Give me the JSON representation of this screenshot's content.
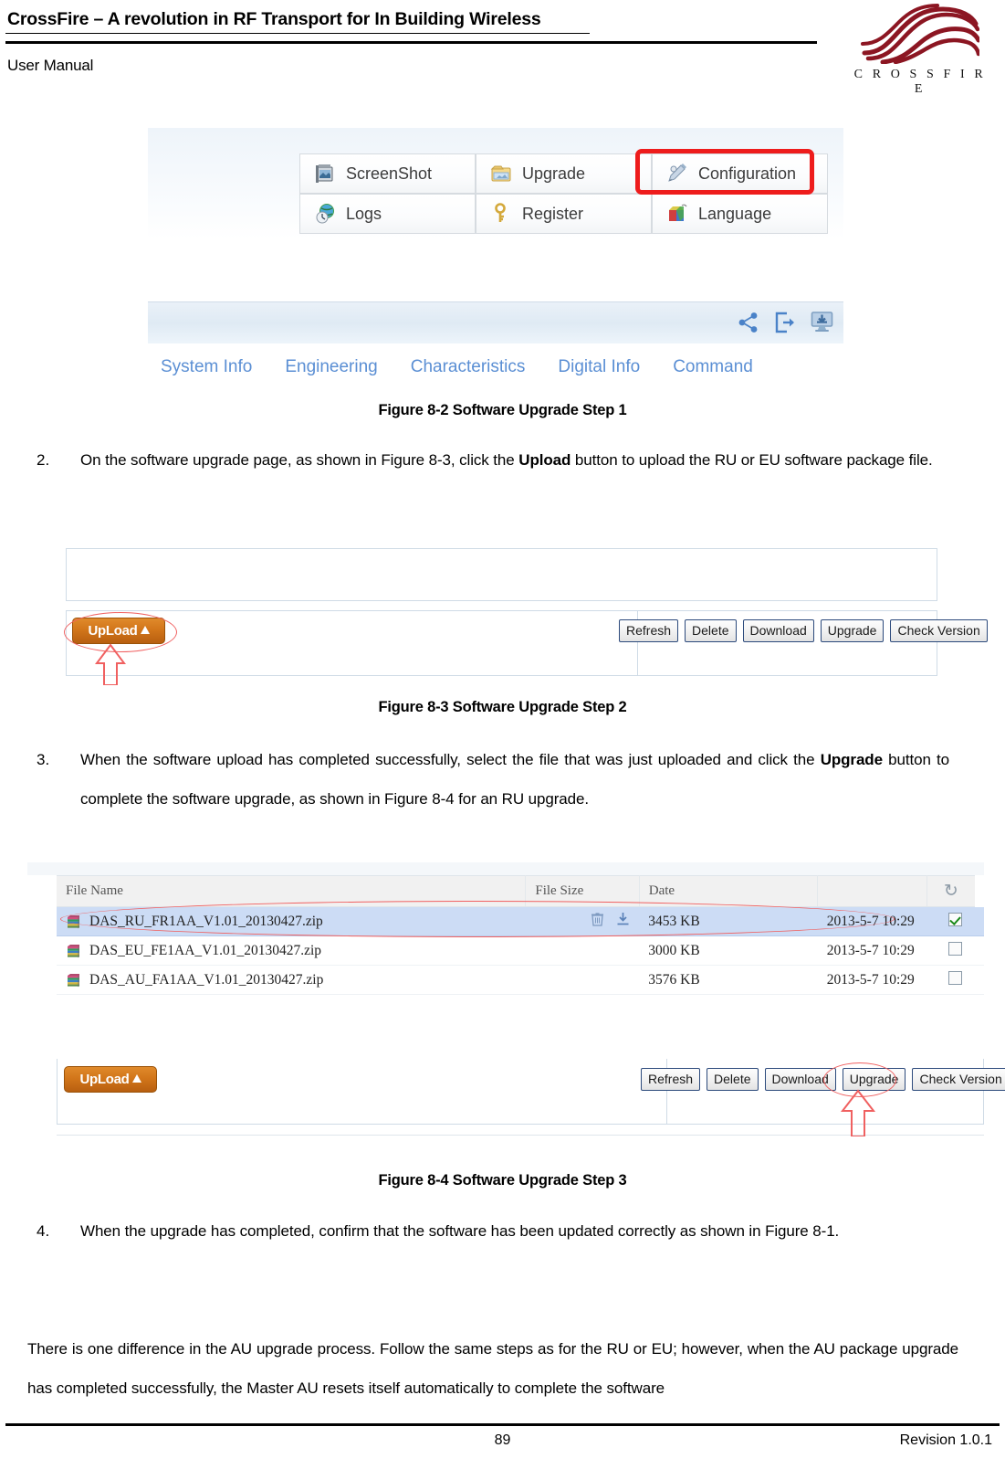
{
  "header": {
    "title": "CrossFire – A revolution in RF Transport for In Building Wireless",
    "subtitle": "User Manual",
    "logo_text": "C R O S S F I R E",
    "logo_icon": "crossfire-wave-logo"
  },
  "figure_8_2": {
    "menu_buttons": [
      {
        "label": "ScreenShot",
        "icon": "screenshot-icon",
        "highlighted": false
      },
      {
        "label": "Upgrade",
        "icon": "upgrade-folder-icon",
        "highlighted": true
      },
      {
        "label": "Configuration",
        "icon": "configuration-pencil-icon",
        "highlighted": false
      },
      {
        "label": "Logs",
        "icon": "logs-globe-icon",
        "highlighted": false
      },
      {
        "label": "Register",
        "icon": "register-key-icon",
        "highlighted": false
      },
      {
        "label": "Language",
        "icon": "language-cube-icon",
        "highlighted": false
      }
    ],
    "toolbar_icons": [
      "share-icon",
      "export-icon",
      "download-to-computer-icon"
    ],
    "tabs": [
      "System Info",
      "Engineering",
      "Characteristics",
      "Digital Info",
      "Command"
    ],
    "caption": "Figure 8-2 Software Upgrade Step 1"
  },
  "step_2": {
    "number": "2.",
    "text_before_bold": "On the software upgrade page, as shown in Figure 8-3, click the ",
    "bold_word": "Upload",
    "text_after_bold": " button to upload the RU or EU software package file."
  },
  "figure_8_3": {
    "upload_label": "UpLoad",
    "upload_icon": "upload-arrow-icon",
    "buttons": [
      "Refresh",
      "Delete",
      "Download",
      "Upgrade",
      "Check Version"
    ],
    "highlight_target": "UpLoad",
    "caption": "Figure 8-3 Software Upgrade Step 2"
  },
  "step_3": {
    "number": "3.",
    "text_before_bold": "When the software upload has completed successfully, select the file that was just uploaded and click the ",
    "bold_word": "Upgrade",
    "text_after_bold": " button to complete the software upgrade, as shown in Figure 8-4 for an RU upgrade."
  },
  "figure_8_4": {
    "table": {
      "columns": [
        "File Name",
        "File Size",
        "Date",
        "",
        ""
      ],
      "refresh_icon": "refresh-icon",
      "rows": [
        {
          "icon": "zip-archive-icon",
          "file_name": "DAS_RU_FR1AA_V1.01_20130427.zip",
          "file_size": "3453 KB",
          "date": "2013-5-7 10:29",
          "checked": true,
          "selected": true,
          "actions": [
            "delete-icon",
            "download-icon"
          ]
        },
        {
          "icon": "zip-archive-icon",
          "file_name": "DAS_EU_FE1AA_V1.01_20130427.zip",
          "file_size": "3000 KB",
          "date": "2013-5-7 10:29",
          "checked": false,
          "selected": false,
          "actions": []
        },
        {
          "icon": "zip-archive-icon",
          "file_name": "DAS_AU_FA1AA_V1.01_20130427.zip",
          "file_size": "3576 KB",
          "date": "2013-5-7 10:29",
          "checked": false,
          "selected": false,
          "actions": []
        }
      ]
    },
    "upload_label": "UpLoad",
    "buttons": [
      "Refresh",
      "Delete",
      "Download",
      "Upgrade",
      "Check Version"
    ],
    "highlight_target": "Upgrade",
    "caption": "Figure 8-4 Software Upgrade Step 3"
  },
  "step_4": {
    "number": "4.",
    "text": "When the upgrade has completed, confirm that the software has been updated correctly as shown in Figure 8-1."
  },
  "closing_paragraph": {
    "text": "There is one difference in the AU upgrade process. Follow the same steps as for the RU or EU; however, when the AU package upgrade has completed successfully, the Master AU resets itself automatically to complete the software"
  },
  "footer": {
    "page_number": "89",
    "revision": "Revision 1.0.1"
  },
  "colors": {
    "highlight_red": "#ee1c1c",
    "annotation_red": "#f06060",
    "tab_blue": "#5b8fd4",
    "selected_row_blue": "#ccdcf5",
    "upload_orange": "#d2761a",
    "logo_dark_red": "#8c1622"
  }
}
